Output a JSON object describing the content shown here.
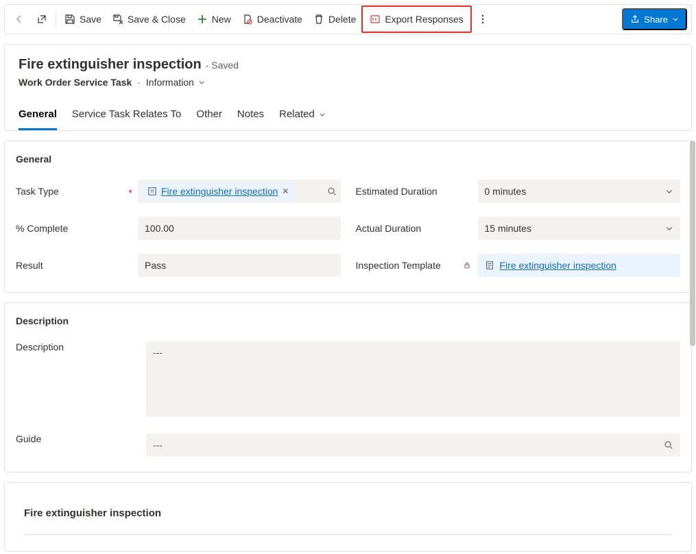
{
  "cmdbar": {
    "save": "Save",
    "saveClose": "Save & Close",
    "new": "New",
    "deactivate": "Deactivate",
    "delete": "Delete",
    "exportResponses": "Export Responses",
    "share": "Share"
  },
  "header": {
    "title": "Fire extinguisher inspection",
    "savedTag": "- Saved",
    "entity": "Work Order Service Task",
    "form": "Information"
  },
  "tabs": {
    "general": "General",
    "relatesTo": "Service Task Relates To",
    "other": "Other",
    "notes": "Notes",
    "related": "Related"
  },
  "sectionGeneral": {
    "heading": "General",
    "labels": {
      "taskType": "Task Type",
      "estDuration": "Estimated Duration",
      "pctComplete": "% Complete",
      "actDuration": "Actual Duration",
      "result": "Result",
      "inspectionTemplate": "Inspection Template"
    },
    "values": {
      "taskType": "Fire extinguisher inspection",
      "estDuration": "0 minutes",
      "pctComplete": "100.00",
      "actDuration": "15 minutes",
      "result": "Pass",
      "inspectionTemplate": "Fire extinguisher inspection"
    }
  },
  "sectionDescription": {
    "heading": "Description",
    "labels": {
      "description": "Description",
      "guide": "Guide"
    },
    "values": {
      "description": "---",
      "guide": "---"
    }
  },
  "bottom": {
    "title": "Fire extinguisher inspection"
  }
}
